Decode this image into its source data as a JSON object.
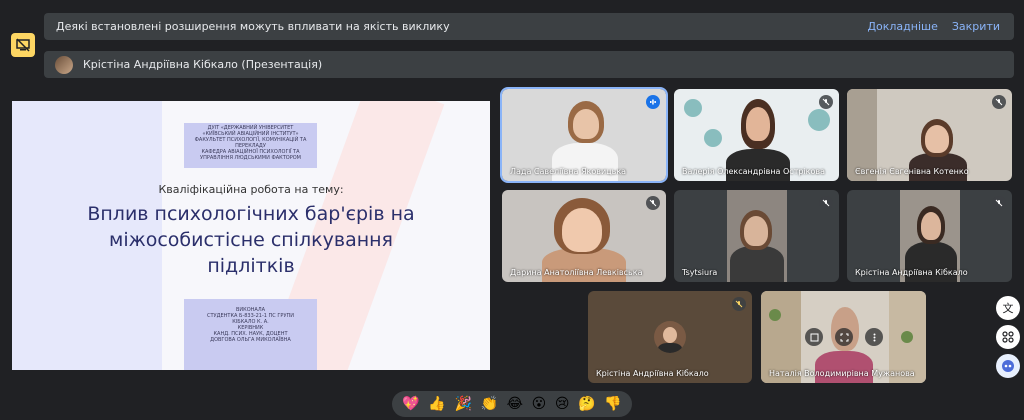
{
  "banner": {
    "message": "Деякі встановлені розширення можуть впливати на якість виклику",
    "details_link": "Докладніше",
    "close_link": "Закрити"
  },
  "presentation": {
    "presenter_label": "Крістіна Андріївна Кібкало (Презентація)"
  },
  "slide": {
    "institution_lines": [
      "ДУІТ «ДЕРЖАВНИЙ УНІВЕРСИТЕТ",
      "«КИЇВСЬКИЙ АВІАЦІЙНИЙ ІНСТИТУТ»",
      "ФАКУЛЬТЕТ ПСИХОЛОГІЇ, КОМУНІКАЦІЙ ТА",
      "ПЕРЕКЛАДУ",
      "КАФЕДРА АВІАЦІЙНОЇ ПСИХОЛОГІЇ ТА",
      "УПРАВЛІННЯ ЛЮДСЬКИМИ ФАКТОРОМ"
    ],
    "subtitle": "Кваліфікаційна робота на тему:",
    "title_lines": [
      "Вплив психологічних бар'єрів на",
      "міжособистісне спілкування",
      "підлітків"
    ],
    "author_lines": [
      "ВИКОНАЛА",
      "СТУДЕНТКА Б-833-21-1 ПС ГРУПИ",
      "КІБКАЛО К. А.",
      "КЕРІВНИК",
      "КАНД. ПСИХ. НАУК, ДОЦЕНТ",
      "ДОВГОВА ОЛЬГА МИКОЛАЇВНА"
    ]
  },
  "participants": [
    {
      "name": "Лада Савеліївна Яковицька",
      "speaking": true
    },
    {
      "name": "Валерія Олександрівна Острікова",
      "muted": true
    },
    {
      "name": "Євгенія Євгенівна Котенко",
      "muted": true
    },
    {
      "name": "Дарина Анатоліївна Левківська",
      "muted": true
    },
    {
      "name": "Tsytsiura",
      "muted": true
    },
    {
      "name": "Крістіна Андріївна Кібкало",
      "muted": true
    },
    {
      "name": "Крістіна Андріївна Кібкало",
      "muted": true
    },
    {
      "name": "Наталія Володимирівна Мужанова",
      "muted": false
    }
  ],
  "reactions": [
    "💖",
    "👍",
    "🎉",
    "👏",
    "😂",
    "😮",
    "😢",
    "🤔",
    "👎"
  ],
  "colors": {
    "accent": "#8ab4f8",
    "surface": "#3c4043",
    "background": "#202124",
    "warning": "#fdd663"
  }
}
